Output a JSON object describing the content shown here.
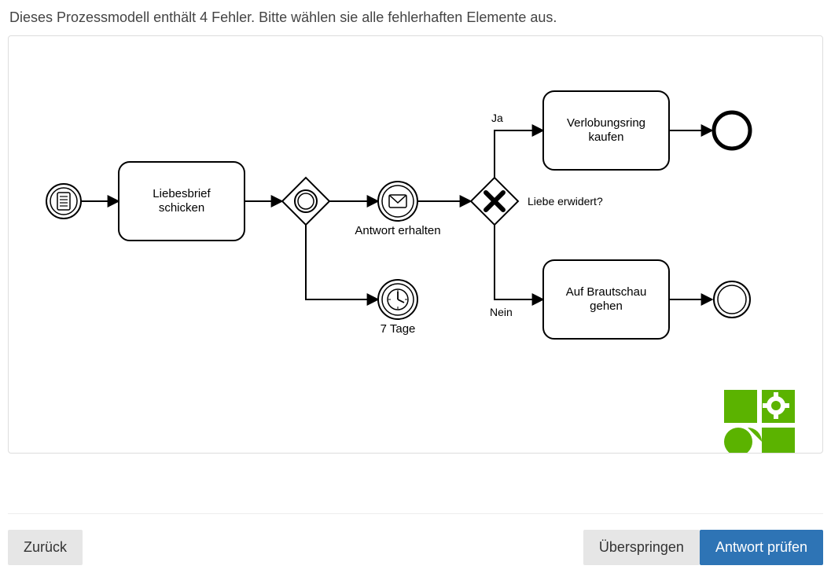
{
  "instruction": "Dieses Prozessmodell enthält 4 Fehler. Bitte wählen sie alle fehlerhaften Elemente aus.",
  "diagram": {
    "nodes": {
      "start_event": {
        "kind": "start-event-conditional"
      },
      "task_liebesbrief": {
        "kind": "task",
        "label_l1": "Liebesbrief",
        "label_l2": "schicken"
      },
      "gateway_event": {
        "kind": "event-based-gateway"
      },
      "event_antwort": {
        "kind": "intermediate-message",
        "label": "Antwort erhalten"
      },
      "event_7tage": {
        "kind": "intermediate-timer",
        "label": "7 Tage"
      },
      "gateway_xor": {
        "kind": "exclusive-gateway",
        "question": "Liebe erwidert?"
      },
      "task_ring": {
        "kind": "task",
        "label_l1": "Verlobungsring",
        "label_l2": "kaufen"
      },
      "task_brautschau": {
        "kind": "task",
        "label_l1": "Auf Brautschau",
        "label_l2": "gehen"
      },
      "end_terminate": {
        "kind": "terminate-end-event"
      },
      "end_normal": {
        "kind": "end-event"
      }
    },
    "edges": {
      "ja": "Ja",
      "nein": "Nein"
    }
  },
  "buttons": {
    "back": "Zurück",
    "skip": "Überspringen",
    "check": "Antwort prüfen"
  }
}
